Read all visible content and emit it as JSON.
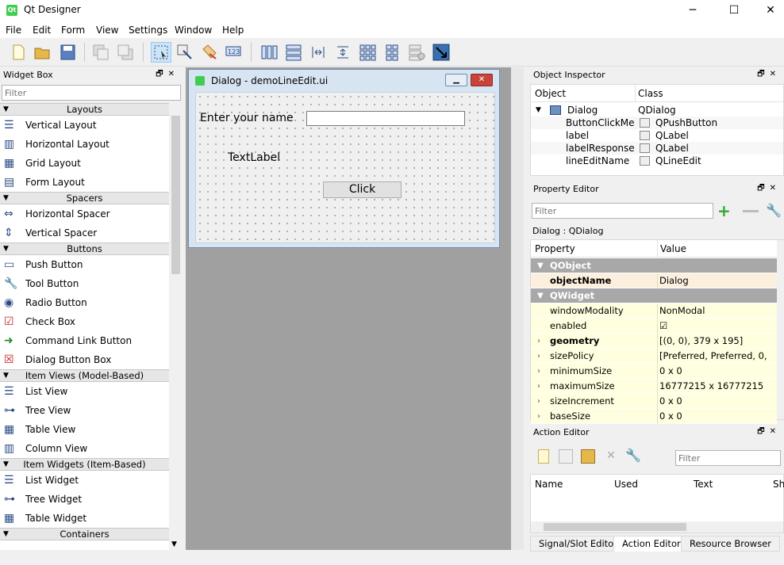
{
  "window": {
    "title": "Qt Designer",
    "minimize": "─",
    "maximize": "☐",
    "close": "✕"
  },
  "menubar": [
    "File",
    "Edit",
    "Form",
    "View",
    "Settings",
    "Window",
    "Help"
  ],
  "widget_box": {
    "title": "Widget Box",
    "filter_placeholder": "Filter",
    "categories": [
      {
        "name": "Layouts",
        "items": [
          "Vertical Layout",
          "Horizontal Layout",
          "Grid Layout",
          "Form Layout"
        ]
      },
      {
        "name": "Spacers",
        "items": [
          "Horizontal Spacer",
          "Vertical Spacer"
        ]
      },
      {
        "name": "Buttons",
        "items": [
          "Push Button",
          "Tool Button",
          "Radio Button",
          "Check Box",
          "Command Link Button",
          "Dialog Button Box"
        ]
      },
      {
        "name": "Item Views (Model-Based)",
        "items": [
          "List View",
          "Tree View",
          "Table View",
          "Column View"
        ]
      },
      {
        "name": "Item Widgets (Item-Based)",
        "items": [
          "List Widget",
          "Tree Widget",
          "Table Widget"
        ]
      },
      {
        "name": "Containers",
        "items": []
      }
    ]
  },
  "form": {
    "window_title": "Dialog - demoLineEdit.ui",
    "label_name": "Enter your name",
    "text_label": "TextLabel",
    "button": "Click"
  },
  "object_inspector": {
    "title": "Object Inspector",
    "col_object": "Object",
    "col_class": "Class",
    "rows": [
      {
        "object": "Dialog",
        "class": "QDialog"
      },
      {
        "object": "ButtonClickMe",
        "class": "QPushButton"
      },
      {
        "object": "label",
        "class": "QLabel"
      },
      {
        "object": "labelResponse",
        "class": "QLabel"
      },
      {
        "object": "lineEditName",
        "class": "QLineEdit"
      }
    ]
  },
  "property_editor": {
    "title": "Property Editor",
    "filter_placeholder": "Filter",
    "context": "Dialog : QDialog",
    "col_property": "Property",
    "col_value": "Value",
    "rows": [
      {
        "name": "QObject",
        "value": "",
        "type": "group"
      },
      {
        "name": "objectName",
        "value": "Dialog",
        "type": "bold"
      },
      {
        "name": "QWidget",
        "value": "",
        "type": "group"
      },
      {
        "name": "windowModality",
        "value": "NonModal",
        "type": "plain"
      },
      {
        "name": "enabled",
        "value": "☑",
        "type": "plain"
      },
      {
        "name": "geometry",
        "value": "[(0, 0), 379 x 195]",
        "type": "boldexp"
      },
      {
        "name": "sizePolicy",
        "value": "[Preferred, Preferred, 0, 0]",
        "type": "exp"
      },
      {
        "name": "minimumSize",
        "value": "0 x 0",
        "type": "exp"
      },
      {
        "name": "maximumSize",
        "value": "16777215 x 16777215",
        "type": "exp"
      },
      {
        "name": "sizeIncrement",
        "value": "0 x 0",
        "type": "exp"
      },
      {
        "name": "baseSize",
        "value": "0 x 0",
        "type": "exp"
      }
    ]
  },
  "action_editor": {
    "title": "Action Editor",
    "filter_placeholder": "Filter",
    "columns": [
      "Name",
      "Used",
      "Text",
      "Sho"
    ]
  },
  "tabs": [
    "Signal/Slot Editor",
    "Action Editor",
    "Resource Browser"
  ],
  "active_tab": "Action Editor",
  "colors": {
    "group_header": "#a8a8a8",
    "selected_row": "#fcefde",
    "property_bg": "#ffffe0",
    "qt_green": "#41cd52"
  }
}
